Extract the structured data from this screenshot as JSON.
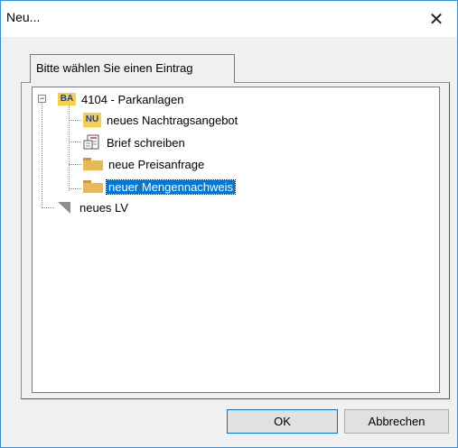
{
  "window": {
    "title": "Neu...",
    "close_glyph": "✕"
  },
  "tab": {
    "label": "Bitte wählen Sie einen Eintrag"
  },
  "tree": {
    "root": {
      "badge": "BA",
      "label": "4104 - Parkanlagen",
      "expander": "−"
    },
    "children": [
      {
        "icon": "nu-badge-icon",
        "badge": "NU",
        "label": "neues Nachtragsangebot"
      },
      {
        "icon": "letter-icon",
        "label": "Brief schreiben"
      },
      {
        "icon": "folder-icon",
        "label": "neue Preisanfrage"
      },
      {
        "icon": "folder-icon",
        "label": "neuer Mengennachweis",
        "selected": true
      }
    ],
    "sibling": {
      "icon": "triangle-icon",
      "label": "neues LV"
    }
  },
  "buttons": {
    "ok": "OK",
    "cancel": "Abbrechen"
  },
  "colors": {
    "selection": "#0078d7",
    "badge_bg": "#f6d04d",
    "badge_text": "#1c3f9f",
    "folder": "#e8b95a"
  }
}
